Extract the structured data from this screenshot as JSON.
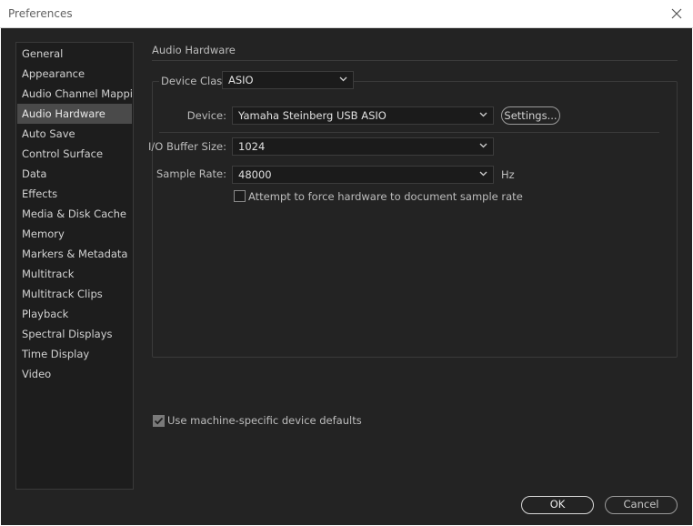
{
  "window": {
    "title": "Preferences"
  },
  "sidebar": {
    "items": [
      {
        "label": "General"
      },
      {
        "label": "Appearance"
      },
      {
        "label": "Audio Channel Mapping"
      },
      {
        "label": "Audio Hardware",
        "selected": true
      },
      {
        "label": "Auto Save"
      },
      {
        "label": "Control Surface"
      },
      {
        "label": "Data"
      },
      {
        "label": "Effects"
      },
      {
        "label": "Media & Disk Cache"
      },
      {
        "label": "Memory"
      },
      {
        "label": "Markers & Metadata"
      },
      {
        "label": "Multitrack"
      },
      {
        "label": "Multitrack Clips"
      },
      {
        "label": "Playback"
      },
      {
        "label": "Spectral Displays"
      },
      {
        "label": "Time Display"
      },
      {
        "label": "Video"
      }
    ]
  },
  "main": {
    "section_title": "Audio Hardware",
    "device_class": {
      "label": "Device Class:",
      "value": "ASIO"
    },
    "device": {
      "label": "Device:",
      "value": "Yamaha Steinberg USB ASIO",
      "settings_label": "Settings..."
    },
    "buffer_size": {
      "label": "I/O Buffer Size:",
      "value": "1024"
    },
    "sample_rate": {
      "label": "Sample Rate:",
      "value": "48000",
      "unit": "Hz"
    },
    "force_rate": {
      "label": "Attempt to force hardware to document sample rate",
      "checked": false
    },
    "machine_defaults": {
      "label": "Use machine-specific device defaults",
      "checked": true
    }
  },
  "footer": {
    "ok_label": "OK",
    "cancel_label": "Cancel"
  },
  "icons": {
    "close": "close-icon",
    "chevron": "chevron-down-icon",
    "check": "checkmark-icon"
  },
  "colors": {
    "background": "#232323",
    "sidebar": "#1d1d1d",
    "selected": "#4a4a4a",
    "text": "#cfcfcf"
  }
}
